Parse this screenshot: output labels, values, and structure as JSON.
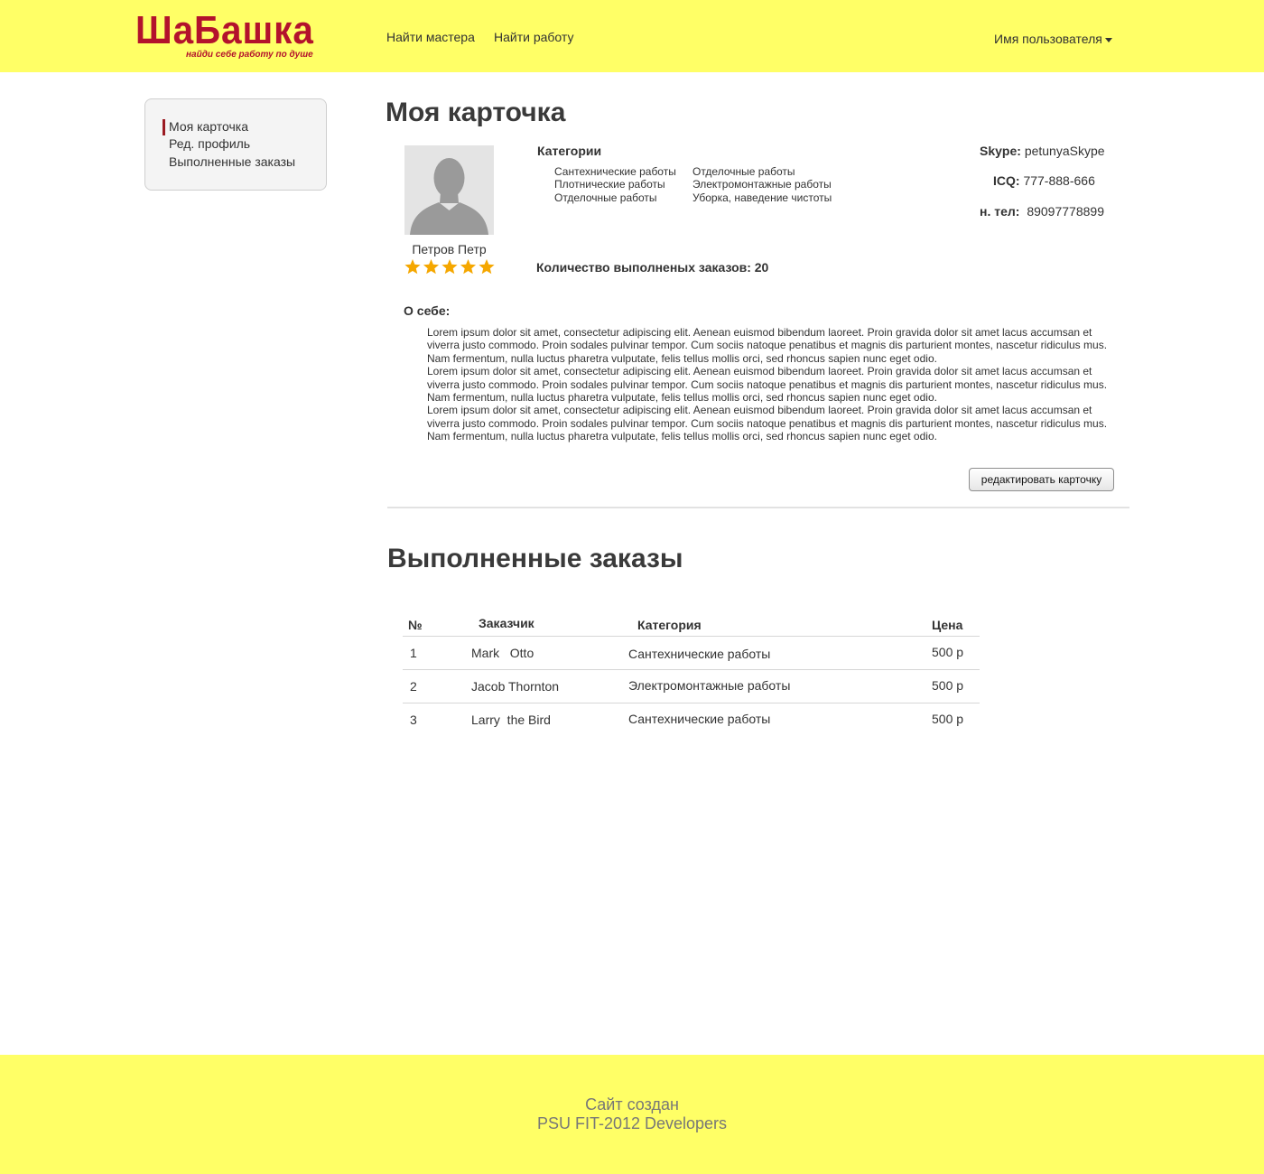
{
  "header": {
    "logo_title": "ШаБашка",
    "logo_subtitle": "найди себе работу по душе",
    "nav": [
      "Найти мастера",
      "Найти работу"
    ],
    "user_menu_label": "Имя пользователя"
  },
  "sidebar": {
    "items": [
      "Моя карточка",
      "Ред. профиль",
      "Выполненные заказы"
    ],
    "active_index": 0
  },
  "card": {
    "title": "Моя карточка",
    "name": "Петров Петр",
    "rating_stars": 5,
    "categories_title": "Категории",
    "categories_col1": [
      "Сантехнические работы",
      "Плотнические работы",
      "Отделочные работы"
    ],
    "categories_col2": [
      "Отделочные работы",
      "Электромонтажные работы",
      "Уборка, наведение чистоты"
    ],
    "skype_label": "Skype:",
    "skype_value": "petunyaSkype",
    "icq_label": "ICQ:",
    "icq_value": "777-888-666",
    "phone_label": "н. тел:",
    "phone_value": "89097778899",
    "orders_count_text": "Количество выполненых заказов: 20",
    "about_label": "О себе:",
    "about_paragraphs": [
      "Lorem ipsum dolor sit amet, consectetur adipiscing elit. Aenean euismod bibendum laoreet. Proin gravida dolor sit amet lacus accumsan et viverra justo commodo. Proin sodales pulvinar tempor. Cum sociis natoque penatibus et magnis dis parturient montes, nascetur ridiculus mus. Nam fermentum, nulla luctus pharetra vulputate, felis tellus mollis orci, sed rhoncus sapien nunc eget odio.",
      "Lorem ipsum dolor sit amet, consectetur adipiscing elit. Aenean euismod bibendum laoreet. Proin gravida dolor sit amet lacus accumsan et viverra justo commodo. Proin sodales pulvinar tempor. Cum sociis natoque penatibus et magnis dis parturient montes, nascetur ridiculus mus. Nam fermentum, nulla luctus pharetra vulputate, felis tellus mollis orci, sed rhoncus sapien nunc eget odio.",
      "Lorem ipsum dolor sit amet, consectetur adipiscing elit. Aenean euismod bibendum laoreet. Proin gravida dolor sit amet lacus accumsan et viverra justo commodo. Proin sodales pulvinar tempor. Cum sociis natoque penatibus et magnis dis parturient montes, nascetur ridiculus mus. Nam fermentum, nulla luctus pharetra vulputate, felis tellus mollis orci, sed rhoncus sapien nunc eget odio."
    ],
    "edit_button_label": "редактировать карточку"
  },
  "orders": {
    "title": "Выполненные заказы",
    "columns": [
      "№",
      "Заказчик",
      "Категория",
      "Цена"
    ],
    "rows": [
      {
        "num": "1",
        "customer": "Mark   Otto",
        "category": "Сантехнические работы",
        "price": "500 р"
      },
      {
        "num": "2",
        "customer": "Jacob Thornton",
        "category": "Электромонтажные работы",
        "price": "500 р"
      },
      {
        "num": "3",
        "customer": "Larry  the Bird",
        "category": "Сантехнические работы",
        "price": "500 р"
      }
    ]
  },
  "footer": {
    "line1": "Сайт создан",
    "line2": "PSU FIT-2012 Developers"
  },
  "colors": {
    "header_bg": "#ffff66",
    "brand_red": "#b3122c",
    "active_bar": "#9b1b22",
    "star": "#f5a700"
  }
}
